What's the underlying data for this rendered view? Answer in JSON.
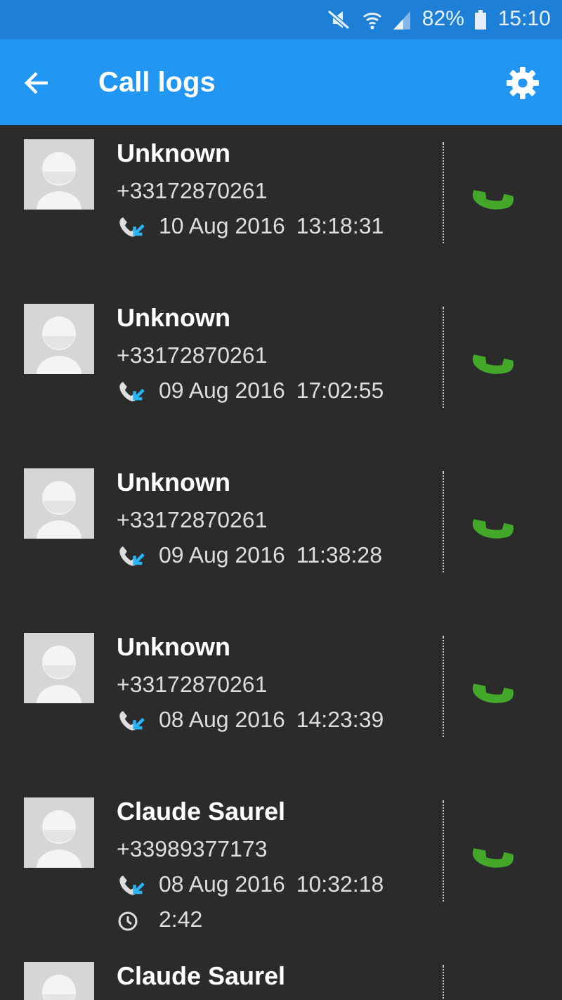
{
  "status_bar": {
    "battery": "82%",
    "time": "15:10"
  },
  "app_bar": {
    "title": "Call logs"
  },
  "calls": [
    {
      "name": "Unknown",
      "number": "+33172870261",
      "date": "10 Aug 2016",
      "time": "13:18:31"
    },
    {
      "name": "Unknown",
      "number": "+33172870261",
      "date": "09 Aug 2016",
      "time": "17:02:55"
    },
    {
      "name": "Unknown",
      "number": "+33172870261",
      "date": "09 Aug 2016",
      "time": "11:38:28"
    },
    {
      "name": "Unknown",
      "number": "+33172870261",
      "date": "08 Aug 2016",
      "time": "14:23:39"
    },
    {
      "name": "Claude Saurel",
      "number": "+33989377173",
      "date": "08 Aug 2016",
      "time": "10:32:18",
      "duration": "2:42"
    },
    {
      "name": "Claude Saurel"
    }
  ]
}
